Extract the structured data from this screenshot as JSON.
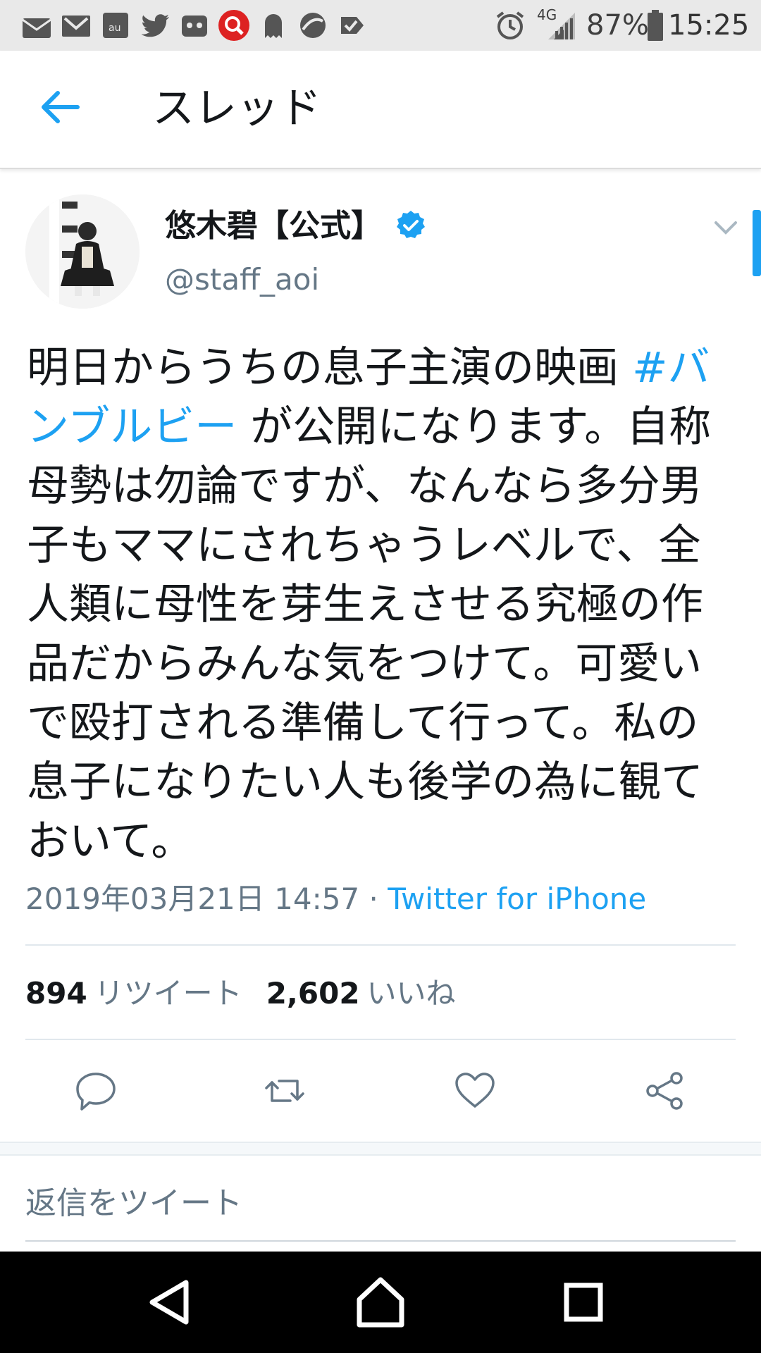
{
  "status_bar": {
    "battery": "87%",
    "time": "15:25",
    "network": "4G",
    "icons": [
      "mail-icon",
      "gmail-icon",
      "au-icon",
      "twitter-icon",
      "app-icon",
      "search-app-icon",
      "ghost-icon",
      "browser-icon",
      "check-icon",
      "alarm-icon",
      "signal-icon",
      "battery-icon"
    ]
  },
  "app_bar": {
    "title": "スレッド"
  },
  "tweet": {
    "display_name": "悠木碧【公式】",
    "screen_name": "@staff_aoi",
    "text_before": "明日からうちの息子主演の映画 ",
    "hashtag": "#バンブルビー",
    "text_after": " が公開になります。自称母勢は勿論ですが、なんなら多分男子もママにされちゃうレベルで、全人類に母性を芽生えさせる究極の作品だからみんな気をつけて。可愛いで殴打される準備して行って。私の息子になりたい人も後学の為に観ておいて。",
    "timestamp": "2019年03月21日 14:57",
    "separator": "·",
    "source": "Twitter for iPhone",
    "retweet_count": "894",
    "retweet_label": "リツイート",
    "like_count": "2,602",
    "like_label": "いいね"
  },
  "reply": {
    "placeholder": "返信をツイート"
  },
  "colors": {
    "accent": "#1da1f2",
    "secondary_text": "#657786",
    "primary_text": "#14171a"
  }
}
